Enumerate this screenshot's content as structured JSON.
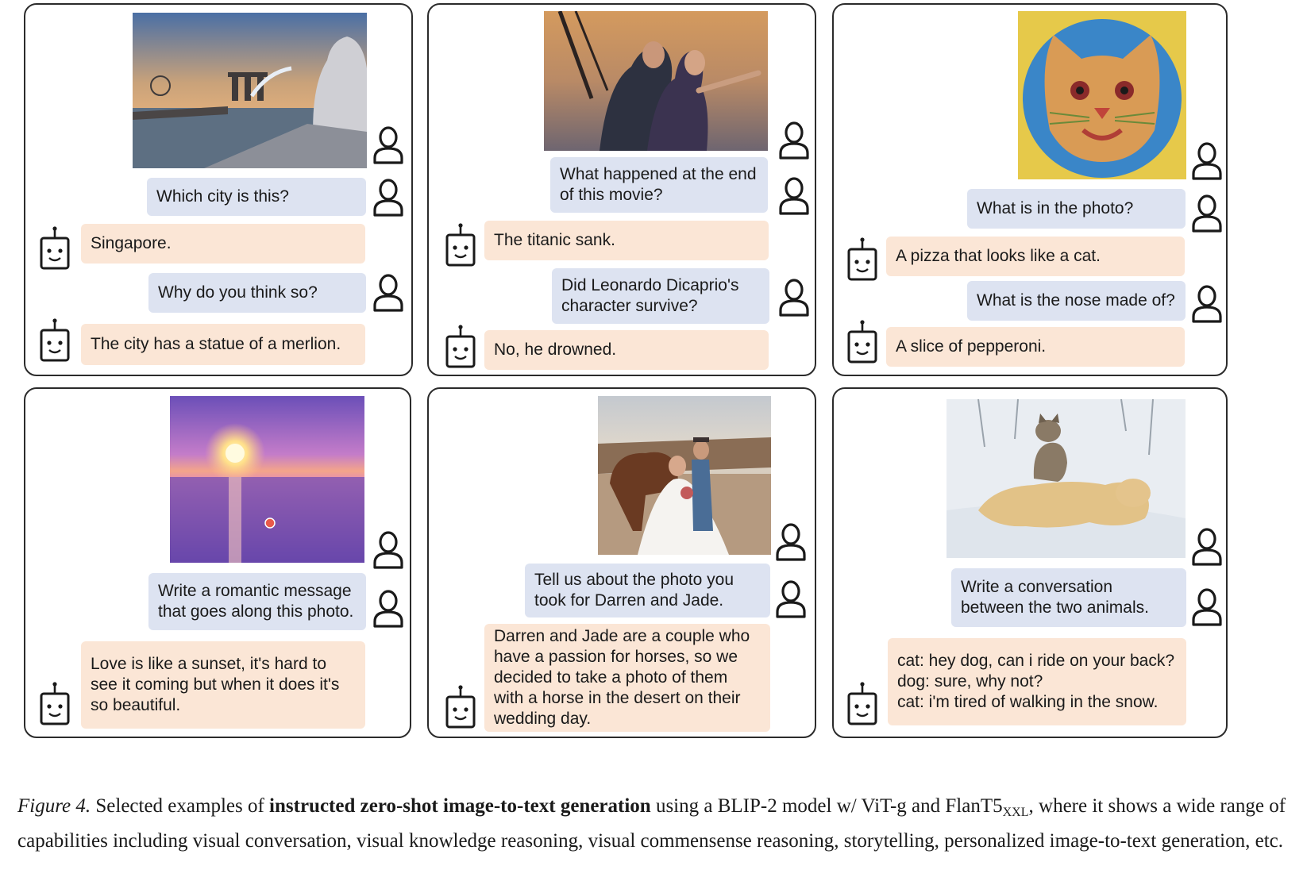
{
  "panels": [
    {
      "image": "merlion-singapore-photo",
      "messages": [
        {
          "role": "user",
          "text": "Which city is this?"
        },
        {
          "role": "bot",
          "text": "Singapore."
        },
        {
          "role": "user",
          "text": "Why do you think so?"
        },
        {
          "role": "bot",
          "text": "The city has a statue of a merlion."
        }
      ]
    },
    {
      "image": "titanic-movie-still",
      "messages": [
        {
          "role": "user",
          "text": "What happened at the end\nof this movie?"
        },
        {
          "role": "bot",
          "text": "The titanic sank."
        },
        {
          "role": "user",
          "text": "Did Leonardo Dicaprio's\ncharacter survive?"
        },
        {
          "role": "bot",
          "text": "No, he drowned."
        }
      ]
    },
    {
      "image": "cat-face-pizza-photo",
      "messages": [
        {
          "role": "user",
          "text": "What is in the photo?"
        },
        {
          "role": "bot",
          "text": "A pizza that looks like a cat."
        },
        {
          "role": "user",
          "text": "What is the nose made of?"
        },
        {
          "role": "bot",
          "text": "A slice of pepperoni."
        }
      ]
    },
    {
      "image": "ocean-sunset-photo",
      "messages": [
        {
          "role": "user",
          "text": "Write a romantic message\nthat goes along this photo."
        },
        {
          "role": "bot",
          "text": "Love is like a sunset, it's hard to\nsee it coming but when it does it's\nso beautiful."
        }
      ]
    },
    {
      "image": "wedding-couple-horse-desert-photo",
      "messages": [
        {
          "role": "user",
          "text": "Tell us about the photo you\ntook for Darren and Jade."
        },
        {
          "role": "bot",
          "text": "Darren and Jade are a couple who\nhave a passion for horses, so we\ndecided to take a photo of them\nwith a horse in the desert on their\nwedding day."
        }
      ]
    },
    {
      "image": "cat-riding-dog-snow-photo",
      "messages": [
        {
          "role": "user",
          "text": "Write a conversation\nbetween the two animals."
        },
        {
          "role": "bot",
          "text": "cat: hey dog, can i ride on your back?\ndog: sure, why not?\ncat: i'm tired of walking in the snow."
        }
      ]
    }
  ],
  "caption": {
    "label": "Figure 4.",
    "text_1": " Selected examples of ",
    "bold": "instructed zero-shot image-to-text generation",
    "text_2": " using a BLIP-2 model w/ ViT-g and FlanT5",
    "subscript": "XXL",
    "text_3": ", where it shows a wide range of capabilities including visual conversation, visual knowledge reasoning, visual commensense reasoning, storytelling, personalized image-to-text generation, etc."
  },
  "icons": {
    "user": "user-outline-icon",
    "bot": "robot-face-icon"
  },
  "colors": {
    "user_bubble": "#dde3f1",
    "bot_bubble": "#fbe6d6",
    "border": "#2b2b2b"
  }
}
